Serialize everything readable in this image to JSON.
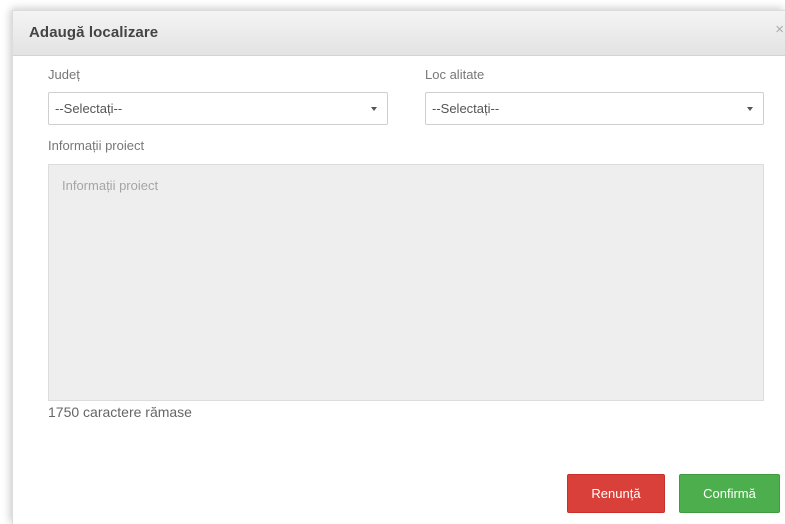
{
  "dialog": {
    "title": "Adaugă localizare",
    "close_label": "×"
  },
  "form": {
    "county": {
      "label": "Județ",
      "value": "--Selectați--"
    },
    "locality": {
      "label": "Loc alitate",
      "value": "--Selectați--"
    },
    "project_info": {
      "label": "Informații proiect",
      "placeholder": "Informații proiect"
    },
    "char_counter": "1750 caractere rămase"
  },
  "buttons": {
    "cancel": "Renunță",
    "confirm": "Confirmă"
  },
  "colors": {
    "cancel": "#d9403a",
    "confirm": "#4cae4c"
  }
}
